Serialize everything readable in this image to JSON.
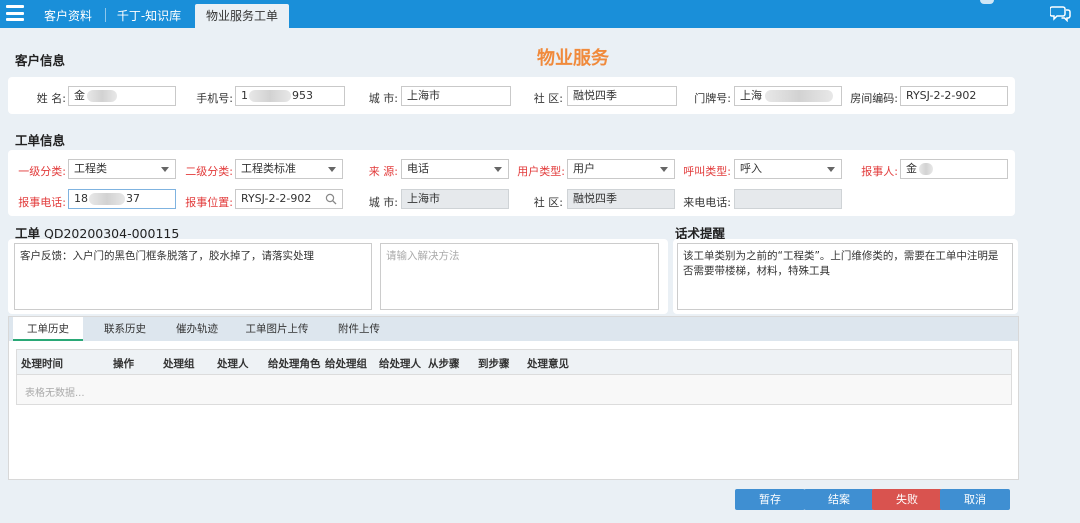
{
  "nav": {
    "tabs": [
      {
        "label": "客户资料"
      },
      {
        "label": "千丁-知识库"
      },
      {
        "label": "物业服务工单"
      }
    ]
  },
  "page_title": "物业服务",
  "customer_info": {
    "title": "客户信息",
    "fields": {
      "name": {
        "label": "姓 名:",
        "value": "金"
      },
      "phone": {
        "label": "手机号:",
        "prefix": "1",
        "suffix": "953"
      },
      "city": {
        "label": "城 市:",
        "value": "上海市"
      },
      "community": {
        "label": "社 区:",
        "value": "融悦四季"
      },
      "door": {
        "label": "门牌号:",
        "value": "上海"
      },
      "room_code": {
        "label": "房间编码:",
        "value": "RYSJ-2-2-902"
      }
    }
  },
  "ticket_info": {
    "title": "工单信息",
    "row1": {
      "cat1": {
        "label": "一级分类:",
        "value": "工程类"
      },
      "cat2": {
        "label": "二级分类:",
        "value": "工程类标准"
      },
      "source": {
        "label": "来 源:",
        "value": "电话"
      },
      "user_type": {
        "label": "用户类型:",
        "value": "用户"
      },
      "call_type": {
        "label": "呼叫类型:",
        "value": "呼入"
      },
      "reporter": {
        "label": "报事人:",
        "value": "金"
      }
    },
    "row2": {
      "report_phone": {
        "label": "报事电话:",
        "prefix": "18",
        "suffix": "37"
      },
      "report_loc": {
        "label": "报事位置:",
        "value": "RYSJ-2-2-902"
      },
      "city": {
        "label": "城 市:",
        "value": "上海市"
      },
      "community": {
        "label": "社 区:",
        "value": "融悦四季"
      },
      "incoming": {
        "label": "来电电话:",
        "value": ""
      }
    }
  },
  "ticket": {
    "prefix": "工单",
    "number": "QD20200304-000115",
    "feedback": "客户反馈：入户门的黑色门框条脱落了，胶水掉了，请落实处理",
    "solution_placeholder": "请输入解决方法"
  },
  "script_tip": {
    "title": "话术提醒",
    "text": "该工单类别为之前的“工程类”。上门维修类的，需要在工单中注明是否需要带楼梯，材料，特殊工具"
  },
  "lower_tabs": [
    {
      "label": "工单历史"
    },
    {
      "label": "联系历史"
    },
    {
      "label": "催办轨迹"
    },
    {
      "label": "工单图片上传"
    },
    {
      "label": "附件上传"
    }
  ],
  "grid": {
    "columns": [
      "处理时间",
      "操作",
      "处理组",
      "处理人",
      "给处理角色",
      "给处理组",
      "给处理人",
      "从步骤",
      "到步骤",
      "处理意见"
    ],
    "empty_text": "表格无数据..."
  },
  "buttons": {
    "save": "暂存",
    "close": "结案",
    "fail": "失败",
    "cancel": "取消"
  },
  "colors": {
    "topbar": "#1a8fd9",
    "accent_orange": "#f08a3c",
    "required_red": "#e23b3b",
    "button_blue": "#3f8fd2",
    "button_red": "#d9534f"
  }
}
